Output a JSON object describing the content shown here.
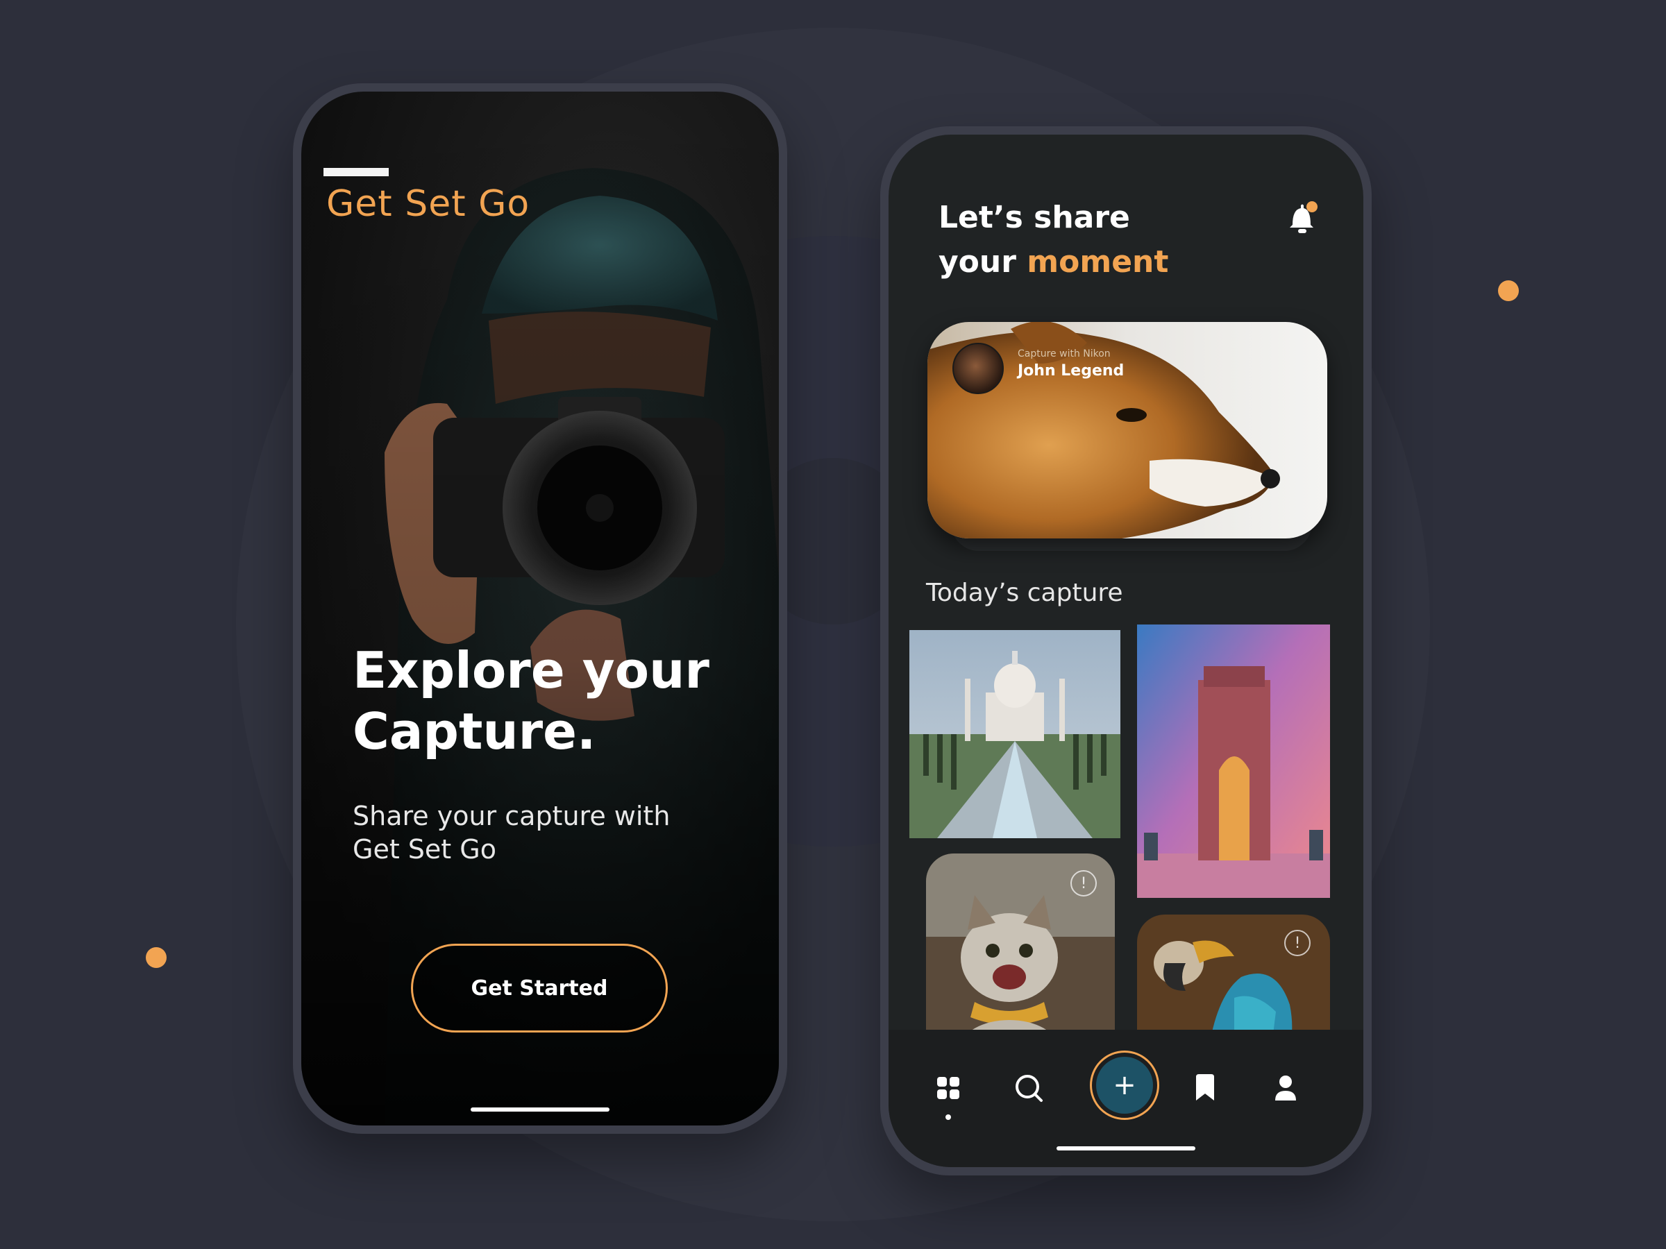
{
  "colors": {
    "accent": "#f2a452",
    "background": "#2d2f3b",
    "screen_dark": "#202324",
    "add_button": "#1d5266"
  },
  "onboarding": {
    "brand_name": "Get Set Go",
    "headline": "Explore your Capture.",
    "subtitle_line1": "Share your capture with",
    "subtitle_line2": "Get Set Go",
    "cta_label": "Get Started"
  },
  "home": {
    "greeting_line1": "Let’s share",
    "greeting_line2_prefix": "your",
    "greeting_line2_accent": "moment",
    "notification_icon": "bell-icon",
    "featured": {
      "caption": "Capture with Nikon",
      "author": "John Legend"
    },
    "section_title": "Today’s capture",
    "thumbnails": [
      {
        "name": "taj-mahal-photo"
      },
      {
        "name": "india-gate-photo"
      },
      {
        "name": "cat-photo",
        "icon": "info-icon",
        "icon_glyph": "!"
      },
      {
        "name": "parrot-photo",
        "icon": "info-icon",
        "icon_glyph": "!"
      }
    ],
    "tabbar": {
      "add_glyph": "+",
      "items": [
        "grid-icon",
        "search-icon",
        "add-icon",
        "bookmark-icon",
        "profile-icon"
      ]
    }
  }
}
